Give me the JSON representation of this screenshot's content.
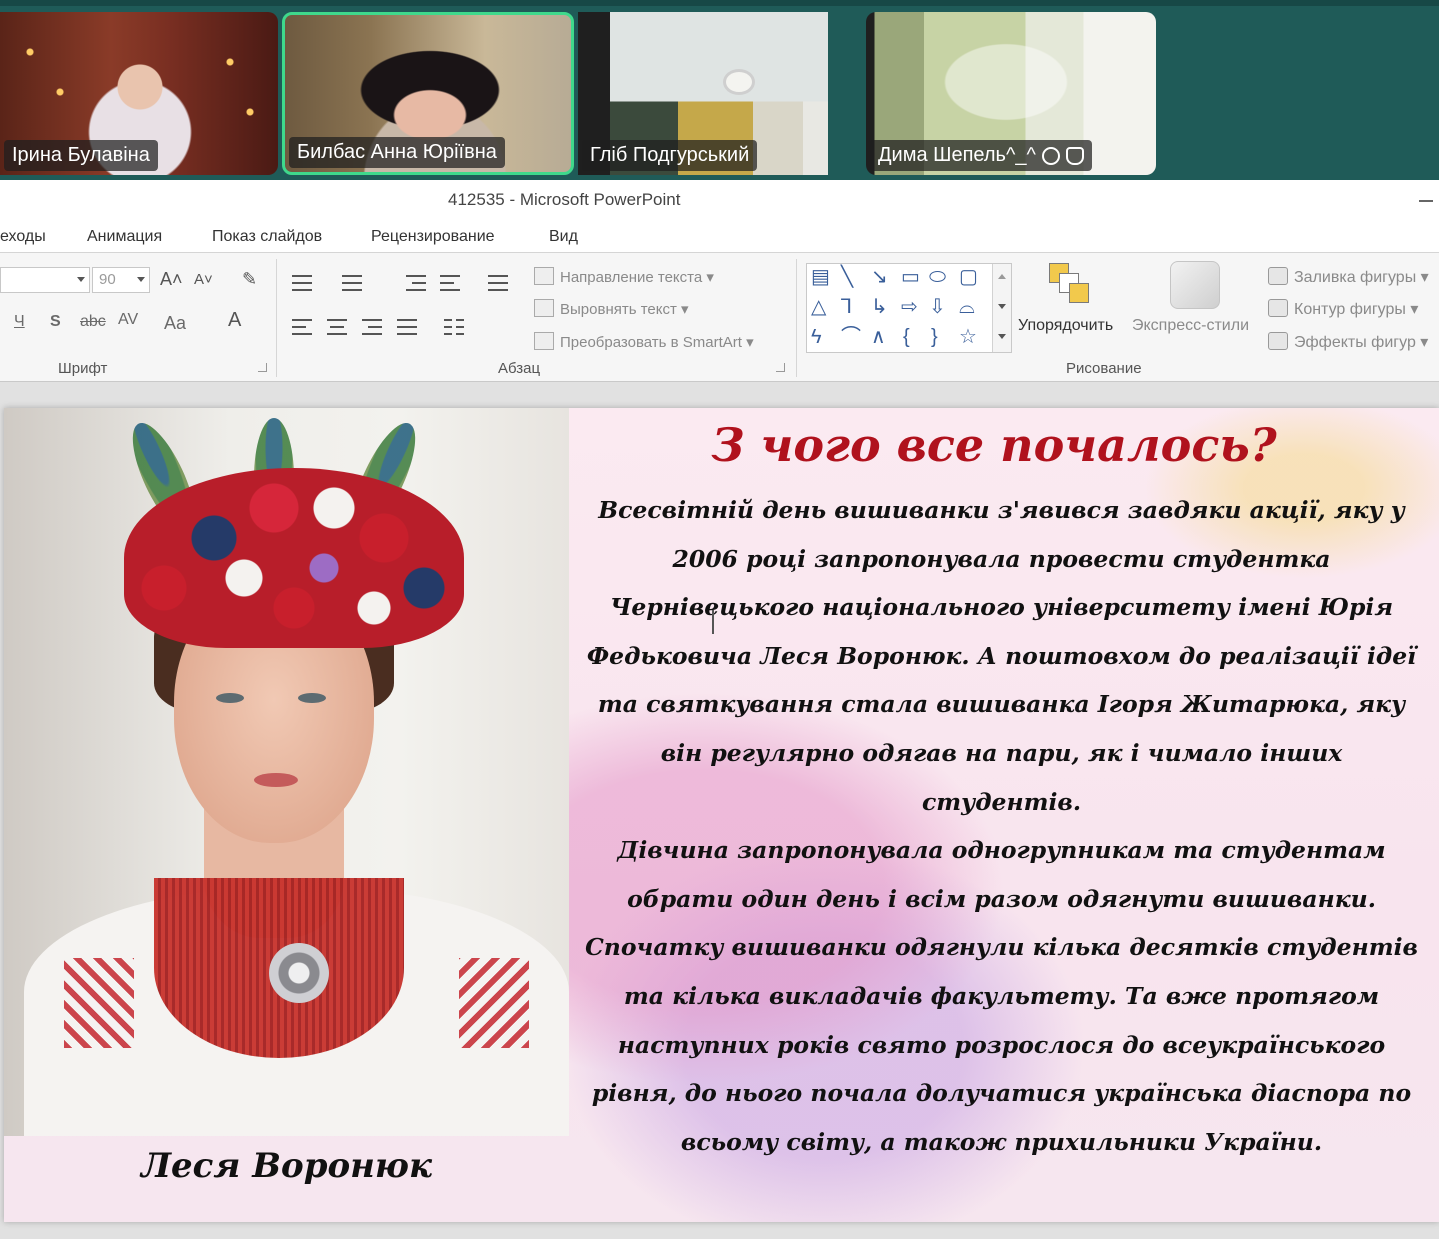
{
  "call": {
    "participants": [
      {
        "name": "Ірина Булавіна",
        "active": false
      },
      {
        "name": "Билбас Анна Юріївна",
        "active": true
      },
      {
        "name": "Гліб Подгурський",
        "active": false
      },
      {
        "name": "Дима Шепель^_^",
        "active": false,
        "icons": [
          "settings-icon",
          "raised-hand-icon"
        ]
      }
    ],
    "active_border_color": "#3fd98c"
  },
  "window": {
    "title": "412535  -  Microsoft PowerPoint"
  },
  "ribbon": {
    "tabs": [
      "еходы",
      "Анимация",
      "Показ слайдов",
      "Рецензирование",
      "Вид"
    ],
    "font_group": {
      "label": "Шрифт",
      "font_size": "90",
      "buttons": {
        "grow": "A˄",
        "shrink": "A˅",
        "underline": "Ч",
        "shadow": "S",
        "strike": "abc",
        "spacing": "AV",
        "case": "Aa",
        "color": "A"
      }
    },
    "paragraph_group": {
      "label": "Абзац",
      "commands": [
        "Направление текста",
        "Выровнять текст",
        "Преобразовать в SmartArt"
      ]
    },
    "drawing_group": {
      "label": "Рисование",
      "arrange": "Упорядочить",
      "quick_styles": "Экспресс-стили",
      "format": [
        "Заливка фигуры",
        "Контур фигуры",
        "Эффекты фигур"
      ]
    }
  },
  "slide": {
    "title": "З чого все почалось?",
    "caption": "Леся Воронюк",
    "paragraphs": [
      "Всесвітній день вишиванки з'явився завдяки акції, яку у 2006 році запропонувала провести студентка Чернівецького національного університету імені Юрія Федьковича Леся Воронюк. А поштовхом до реалізації ідеї та святкування стала вишиванка Ігоря Житарюка, яку він регулярно одягав на пари, як і чимало інших студентів.",
      "Дівчина запропонувала одногрупникам та студентам обрати один день і всім разом одягнути вишиванки. Спочатку вишиванки одягнули кілька десятків студентів та кілька викладачів факультету. Та вже протягом наступних років свято розрослося до всеукраїнського рівня, до нього почала долучатися українська діаспора по всьому світу, а також прихильники України."
    ],
    "title_color": "#b0121d"
  }
}
